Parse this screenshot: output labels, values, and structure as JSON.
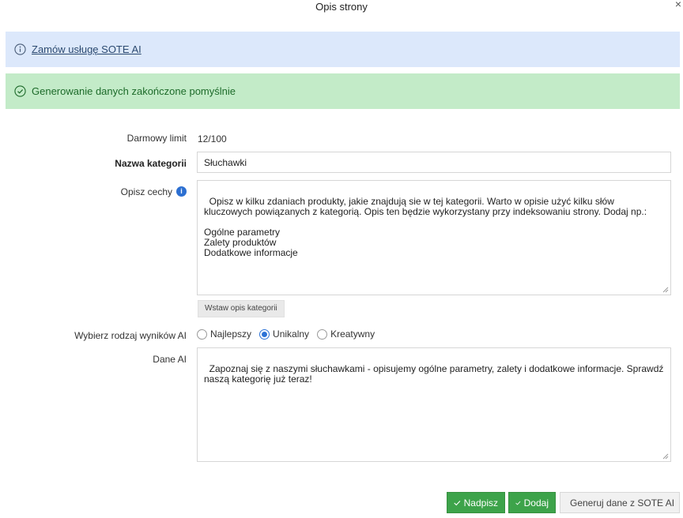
{
  "dialog": {
    "title": "Opis strony",
    "close_glyph": "×"
  },
  "alerts": {
    "info": {
      "icon": "info-circle-icon",
      "link_text": "Zamów usługę SOTE AI"
    },
    "success": {
      "icon": "check-circle-icon",
      "text": "Generowanie danych zakończone pomyślnie"
    }
  },
  "form": {
    "free_limit": {
      "label": "Darmowy limit",
      "value": "12/100"
    },
    "category_name": {
      "label": "Nazwa kategorii",
      "value": "Słuchawki"
    },
    "describe": {
      "label": "Opisz cechy",
      "info_glyph": "i",
      "value": "Opisz w kilku zdaniach produkty, jakie znajdują sie w tej kategorii. Warto w opisie użyć kilku słów kluczowych powiązanych z kategorią. Opis ten będzie wykorzystany przy indeksowaniu strony. Dodaj np.:\n\nOgólne parametry\nZalety produktów\nDodatkowe informacje",
      "insert_button": "Wstaw opis kategorii"
    },
    "result_type": {
      "label": "Wybierz rodzaj wyników AI",
      "options": [
        {
          "label": "Najlepszy",
          "checked": false
        },
        {
          "label": "Unikalny",
          "checked": true
        },
        {
          "label": "Kreatywny",
          "checked": false
        }
      ]
    },
    "ai_data": {
      "label": "Dane AI",
      "value": "Zapoznaj się z naszymi słuchawkami - opisujemy ogólne parametry, zalety i dodatkowe informacje. Sprawdź naszą kategorię już teraz!"
    }
  },
  "footer": {
    "overwrite": "Nadpisz",
    "add": "Dodaj",
    "generate": "Generuj dane z SOTE AI"
  },
  "colors": {
    "info_bg": "#dce8fb",
    "success_bg": "#c3ebc8",
    "primary_green": "#3da34a",
    "radio_blue": "#2d73d6"
  }
}
